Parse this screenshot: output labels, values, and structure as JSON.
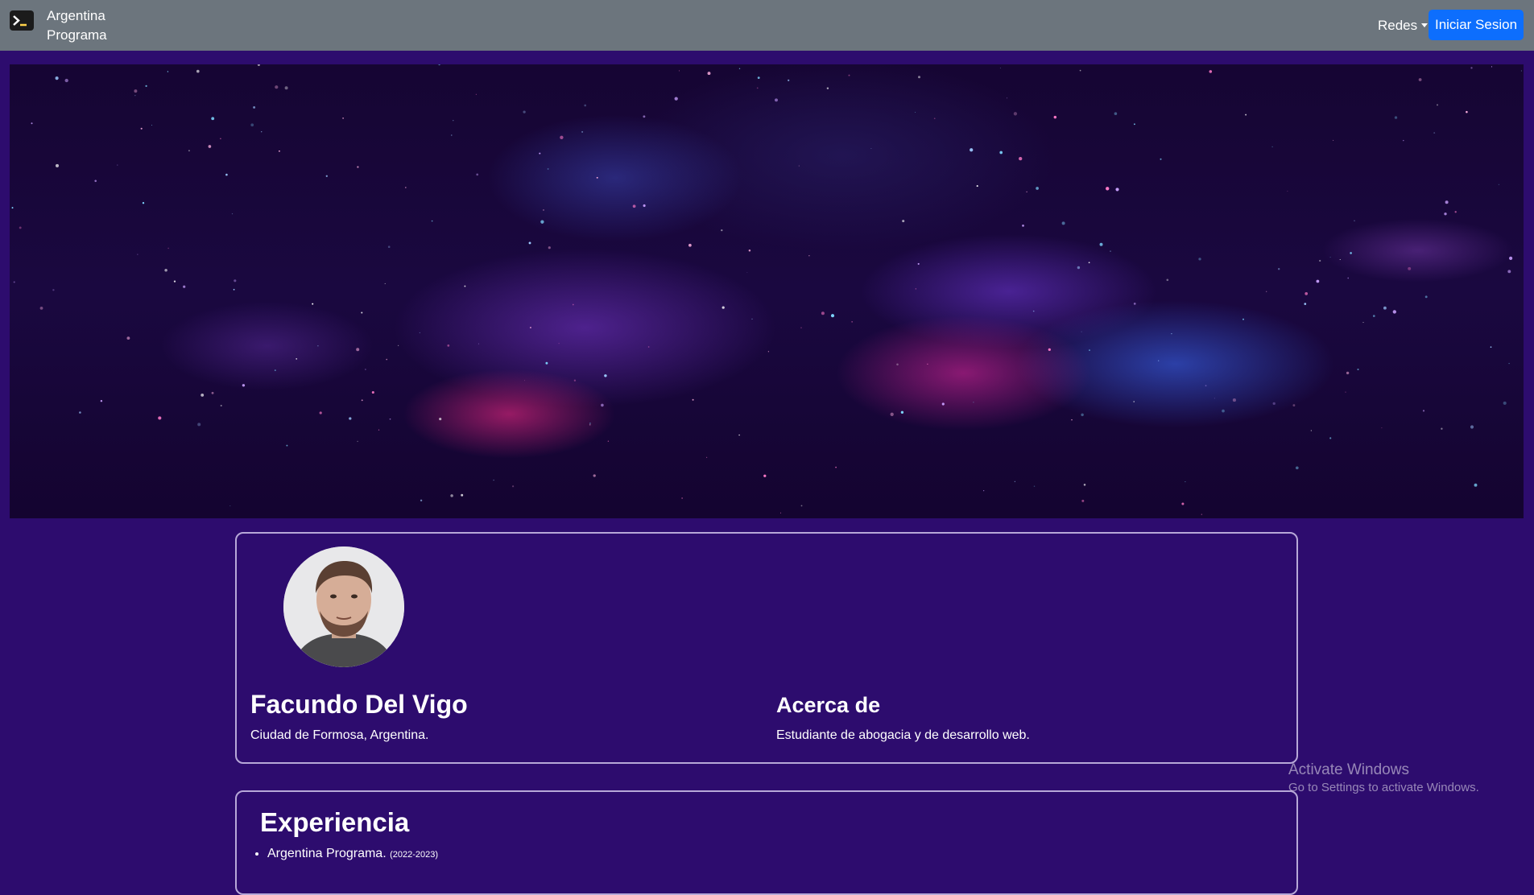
{
  "navbar": {
    "brand": "Argentina Programa",
    "brand_icon": "terminal-icon",
    "redes_label": "Redes",
    "login_label": "Iniciar Sesion",
    "accent_color": "#0d6efd",
    "bar_color": "#6c757d"
  },
  "hero": {
    "image_description": "space-nebula-banner"
  },
  "profile": {
    "name": "Facundo Del Vigo",
    "location": "Ciudad de Formosa, Argentina.",
    "about_title": "Acerca de",
    "about_text": "Estudiante de abogacia y de desarrollo web."
  },
  "experience": {
    "title": "Experiencia",
    "items": [
      {
        "name": "Argentina Programa.",
        "years": "(2022-2023)"
      }
    ]
  },
  "watermark": {
    "title": "Activate Windows",
    "subtitle": "Go to Settings to activate Windows."
  },
  "theme": {
    "background": "#2d0c6e",
    "card_border": "#b7a8d8"
  }
}
